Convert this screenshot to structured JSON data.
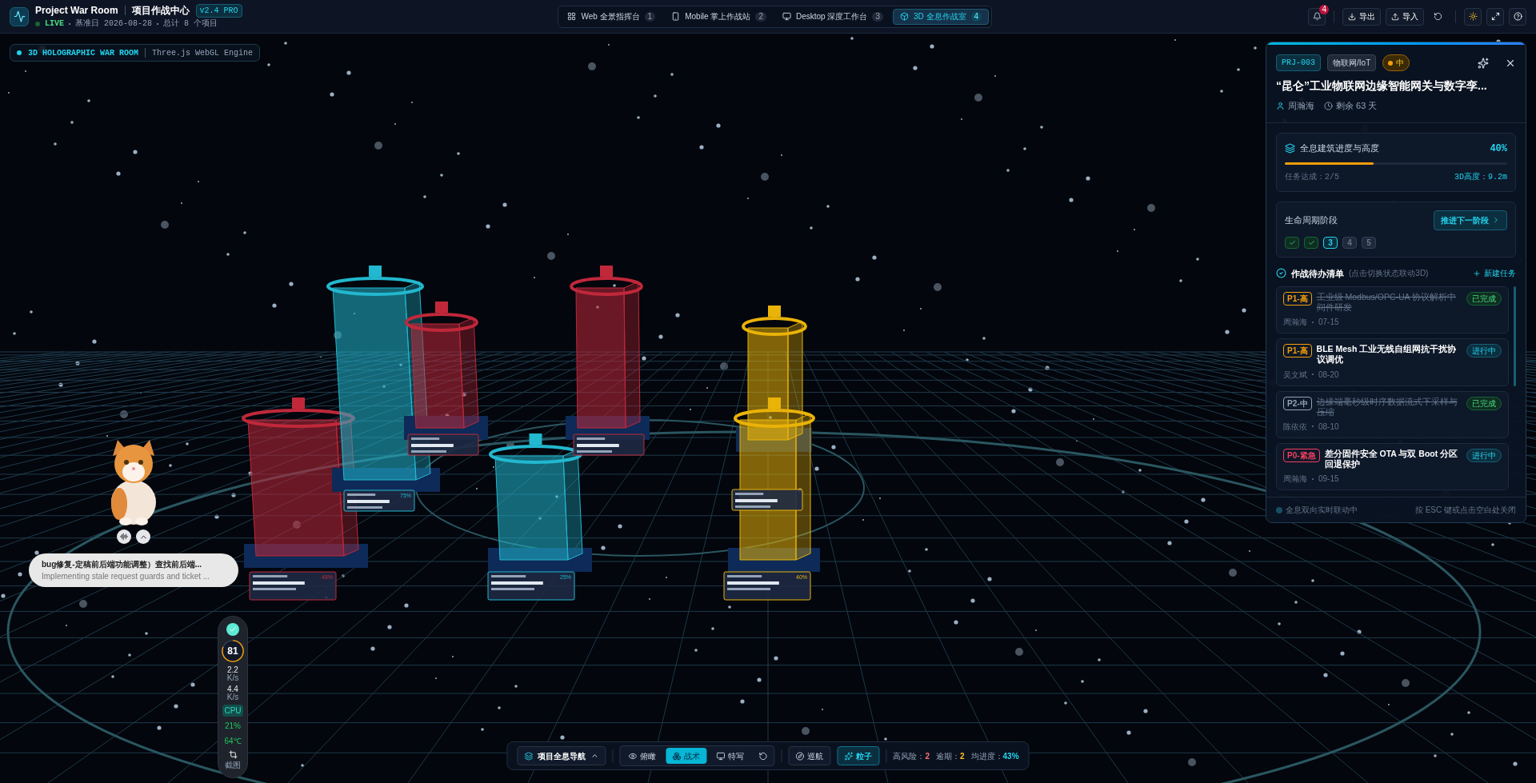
{
  "header": {
    "title": "Project War Room",
    "subtitle": "项目作战中心",
    "version": "v2.4 PRO",
    "live": "LIVE",
    "base_date": "基准日 2026-08-28",
    "total": "总计 8 个项目"
  },
  "view_tabs": [
    {
      "kind": "web",
      "label": "Web 全景指挥台",
      "count": "1",
      "selected": false
    },
    {
      "kind": "mobile",
      "label": "Mobile 掌上作战站",
      "count": "2",
      "selected": false
    },
    {
      "kind": "desktop",
      "label": "Desktop 深度工作台",
      "count": "3",
      "selected": false
    },
    {
      "kind": "hologram",
      "label": "3D 全息作战室",
      "count": "4",
      "selected": true
    }
  ],
  "toolbar": {
    "notifications": "4",
    "export": "导出",
    "import": "导入"
  },
  "scene_badge": {
    "title": "3D HOLOGRAPHIC WAR ROOM",
    "engine": "Three.js WebGL Engine"
  },
  "buildings": [
    {
      "color": "#c0283a",
      "percent": "48%"
    },
    {
      "color": "#22b8cf",
      "percent": "75%"
    },
    {
      "color": "#c0283a"
    },
    {
      "color": "#c0283a"
    },
    {
      "color": "#22b8cf",
      "percent": "25%"
    },
    {
      "color": "#eab308"
    },
    {
      "color": "#eab308",
      "percent": "40%"
    }
  ],
  "detail_panel": {
    "code": "PRJ-003",
    "category": "物联网/IoT",
    "risk": "中",
    "title": "“昆仑”工业物联网边缘智能网关与数字孪...",
    "owner": "周瀚海",
    "remaining": "剩余 63 天",
    "progress": {
      "title": "全息建筑进度与高度",
      "percent": "40%",
      "level": 0.4,
      "tasks": "任务达成：2/5",
      "height": "3D高度：9.2m"
    },
    "lifecycle": {
      "title": "生命周期阶段",
      "button": "推进下一阶段",
      "stages": [
        {
          "kind": "done"
        },
        {
          "kind": "done"
        },
        {
          "kind": "current",
          "label": "3"
        },
        {
          "kind": "pending",
          "label": "4"
        },
        {
          "kind": "pending",
          "label": "5"
        }
      ]
    },
    "todo": {
      "title": "作战待办清单",
      "hint": "(点击切换状态联动3D)",
      "add": "新建任务",
      "items": [
        {
          "priority": "P1-高",
          "color": "#f59e0b",
          "title": "工业级 Modbus/OPC-UA 协议解析中间件研发",
          "owner": "周瀚海",
          "date": "07-15",
          "status": "已完成",
          "done": true
        },
        {
          "priority": "P1-高",
          "color": "#f59e0b",
          "title": "BLE Mesh 工业无线自组网抗干扰协议调优",
          "owner": "吴文斌",
          "date": "08-20",
          "status": "进行中",
          "done": false
        },
        {
          "priority": "P2-中",
          "color": "#94a3b8",
          "title": "边缘端毫秒级时序数据流式下采样与压缩",
          "owner": "陈依依",
          "date": "08-10",
          "status": "已完成",
          "done": true
        },
        {
          "priority": "P0-紧急",
          "color": "#f43f5e",
          "title": "差分固件安全 OTA 与双 Boot 分区回退保护",
          "owner": "周瀚海",
          "date": "09-15",
          "status": "进行中",
          "done": false
        }
      ]
    },
    "footer_status": "全息双向实时联动中",
    "footer_hint": "按 ESC 键或点击空白处关闭"
  },
  "assistant": {
    "title": "bug修复-定稿前后端功能调整）查找前后端...",
    "subtitle": "Implementing stale request guards and ticket ..."
  },
  "monitor": {
    "score": "81",
    "level": 0.81,
    "upload": "2.2",
    "upload_unit": "K/s",
    "download": "4.4",
    "download_unit": "K/s",
    "cpu_label": "CPU",
    "cpu": "21%",
    "temp": "64℃",
    "screenshot": "截图"
  },
  "bottom_bar": {
    "nav": "项目全息导航",
    "views": [
      {
        "kind": "overview",
        "label": "俯瞰",
        "selected": false
      },
      {
        "kind": "tactical",
        "label": "战术",
        "selected": true
      },
      {
        "kind": "closeup",
        "label": "特写",
        "selected": false
      }
    ],
    "cruise": {
      "label": "巡航",
      "on": false
    },
    "particles": {
      "label": "粒子",
      "on": true
    },
    "stats": [
      {
        "label": "高风险：",
        "value": "2",
        "color": "#f87171"
      },
      {
        "label": "逾期：",
        "value": "2",
        "color": "#fbbf24"
      },
      {
        "label": "均进度：",
        "value": "43%",
        "color": "#22d3ee"
      }
    ]
  }
}
